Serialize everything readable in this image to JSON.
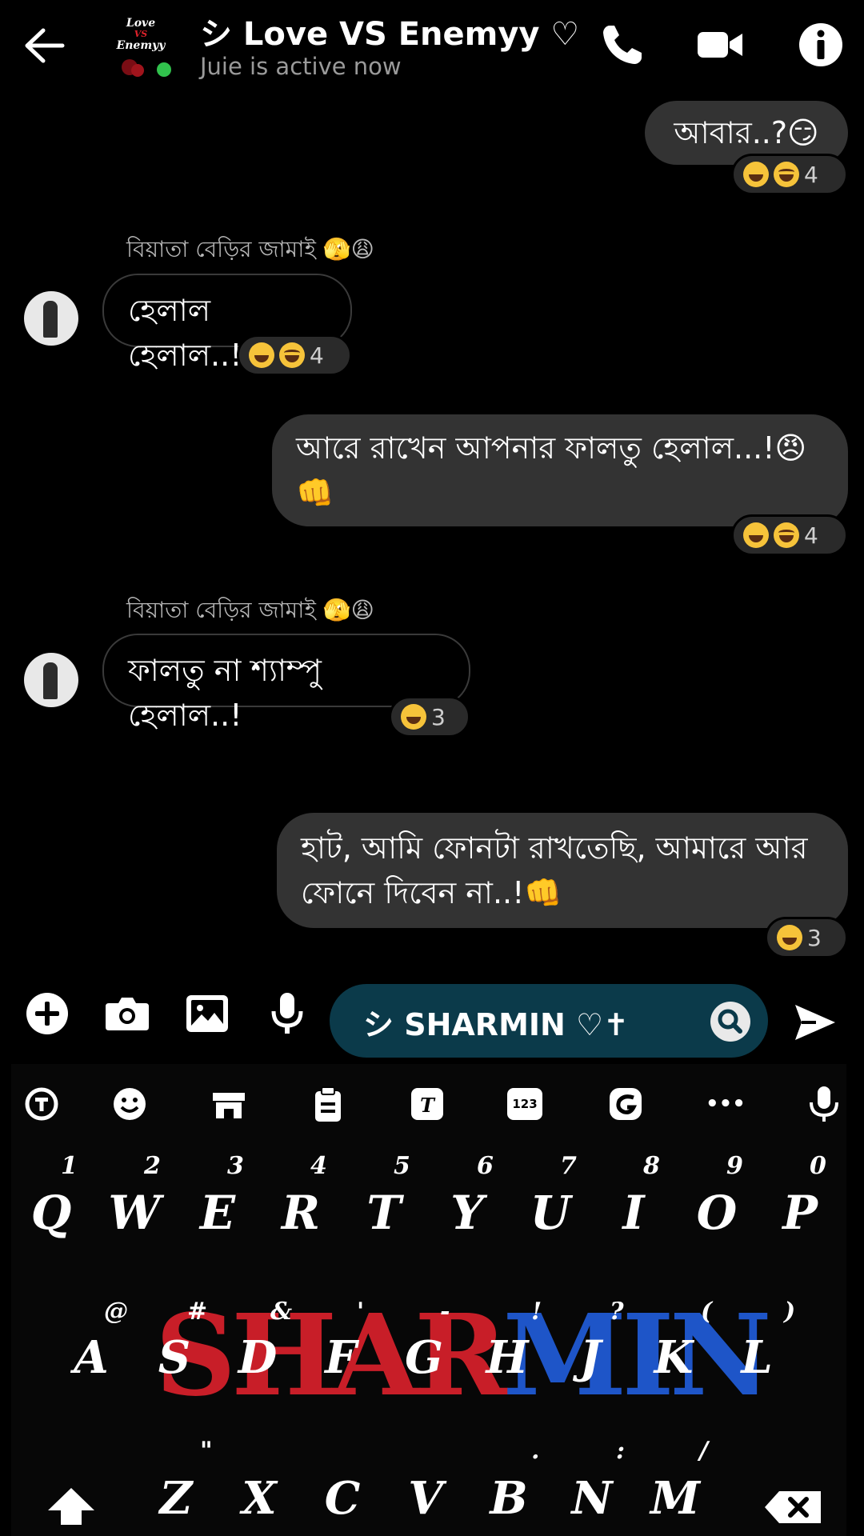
{
  "header": {
    "title": "シ Love VS Enemyy ♡",
    "status": "Juie is active now",
    "logo_text_1": "Love",
    "logo_text_2": "VS",
    "logo_text_3": "Enemyy"
  },
  "messages": [
    {
      "dir": "out",
      "text": "আবার..?😏",
      "reaction_count": "4"
    },
    {
      "dir": "in",
      "sender": "বিয়াতা বেড়ির জামাই 🫣😩",
      "text": "হেলাল হেলাল..!",
      "reaction_count": "4"
    },
    {
      "dir": "out",
      "text_line1": "আরে রাখেন আপনার ফালতু হেলাল...!😠",
      "text_line2": "👊",
      "reaction_count": "4"
    },
    {
      "dir": "in",
      "sender": "বিয়াতা বেড়ির জামাই 🫣😩",
      "text": "ফালতু না শ্যাম্পু হেলাল..!",
      "reaction_count": "3"
    },
    {
      "dir": "out",
      "text_line1": "হাট, আমি ফোনটা রাখতেছি, আমারে আর",
      "text_line2": "ফোনে দিবেন না..!👊",
      "reaction_count": "3"
    }
  ],
  "composer": {
    "input_value": "シ SHARMIN ♡✝"
  },
  "keyboard": {
    "toolbar_123": "123",
    "toolbar_more": "•••",
    "numbers": [
      "1",
      "2",
      "3",
      "4",
      "5",
      "6",
      "7",
      "8",
      "9",
      "0"
    ],
    "row1": [
      "Q",
      "W",
      "E",
      "R",
      "T",
      "Y",
      "U",
      "I",
      "O",
      "P"
    ],
    "row2_hints": [
      "@",
      "#",
      "&",
      "'",
      "-",
      "!",
      "?",
      "(",
      ")"
    ],
    "row2": [
      "A",
      "S",
      "D",
      "F",
      "G",
      "H",
      "J",
      "K",
      "L"
    ],
    "row3_hints": [
      "\"",
      ".",
      ":",
      "/"
    ],
    "row3": [
      "Z",
      "X",
      "C",
      "V",
      "B",
      "N",
      "M"
    ],
    "theme_banner_1": "SHAR",
    "theme_banner_2": "MIN"
  },
  "colors": {
    "active_green": "#31c24d",
    "outgoing_bubble": "#333333",
    "input_bg": "#0b3a4a",
    "banner_red": "#c81e28",
    "banner_blue": "#1e55c8"
  }
}
